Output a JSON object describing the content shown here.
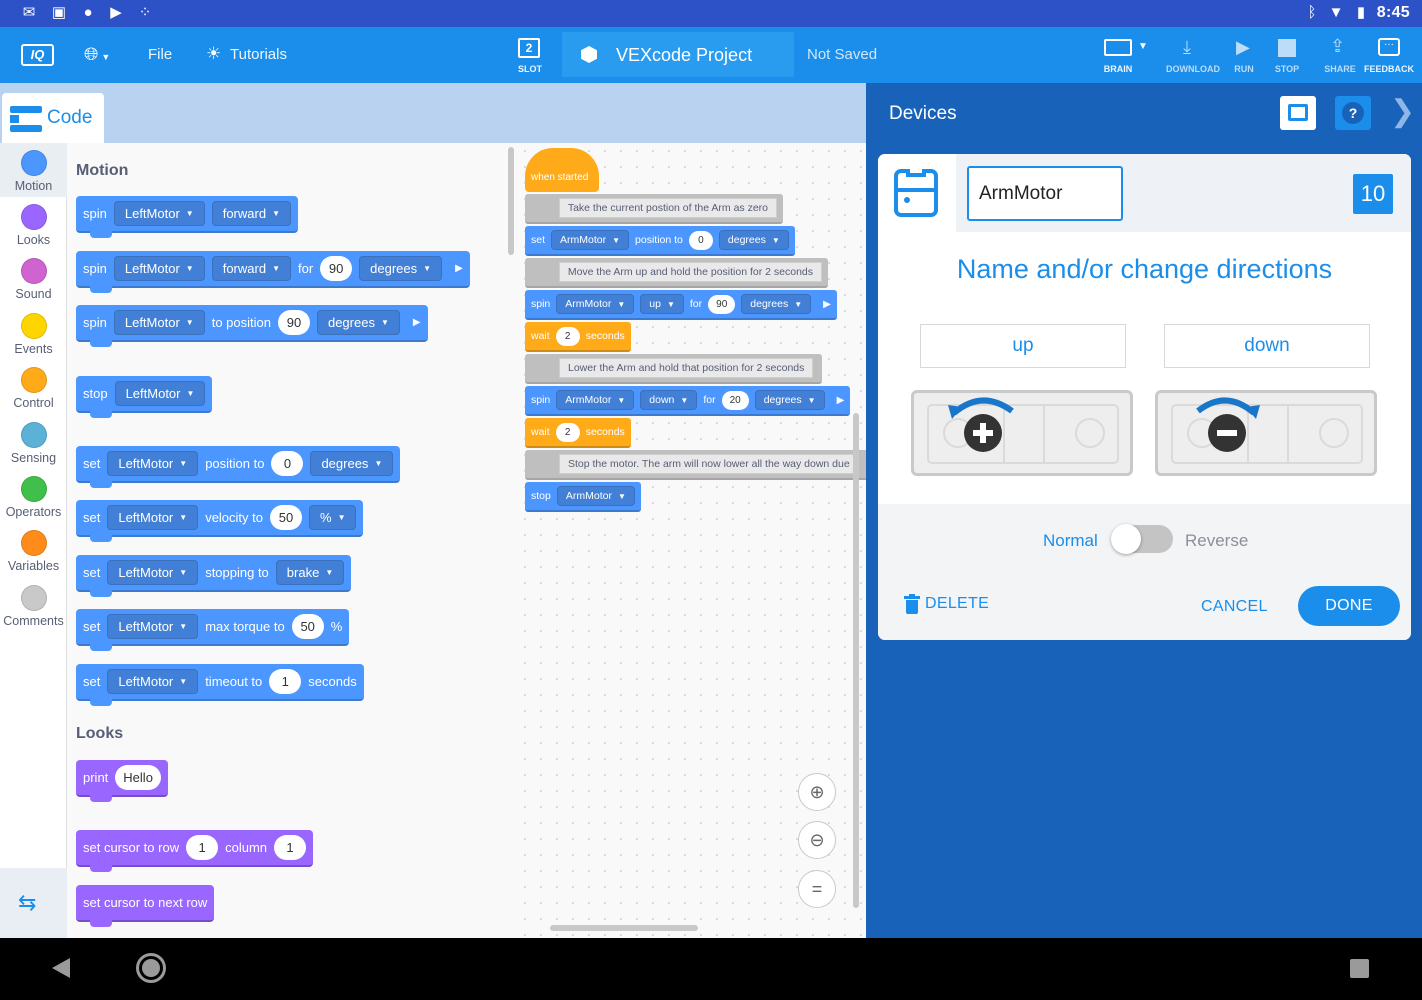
{
  "status_bar": {
    "time": "8:45"
  },
  "toolbar": {
    "file_label": "File",
    "tutorials_label": "Tutorials",
    "slot_number": "2",
    "slot_label": "SLOT",
    "project_name": "VEXcode Project",
    "save_status": "Not Saved",
    "brain_label": "BRAIN",
    "download_label": "DOWNLOAD",
    "run_label": "RUN",
    "stop_label": "STOP",
    "share_label": "SHARE",
    "feedback_label": "FEEDBACK"
  },
  "code_tab": {
    "label": "Code"
  },
  "categories": [
    {
      "label": "Motion",
      "color": "#4c97ff"
    },
    {
      "label": "Looks",
      "color": "#9966ff"
    },
    {
      "label": "Sound",
      "color": "#cf63cf"
    },
    {
      "label": "Events",
      "color": "#ffd500"
    },
    {
      "label": "Control",
      "color": "#ffab19"
    },
    {
      "label": "Sensing",
      "color": "#5cb1d6"
    },
    {
      "label": "Operators",
      "color": "#40bf4a"
    },
    {
      "label": "Variables",
      "color": "#ff8c1a"
    },
    {
      "label": "Comments",
      "color": "#c9c9c9"
    }
  ],
  "palette": {
    "motion_title": "Motion",
    "looks_title": "Looks",
    "blocks": {
      "b1": {
        "op": "spin",
        "motor": "LeftMotor",
        "dir": "forward"
      },
      "b2": {
        "op": "spin",
        "motor": "LeftMotor",
        "dir": "forward",
        "for": "for",
        "value": "90",
        "unit": "degrees"
      },
      "b3": {
        "op": "spin",
        "motor": "LeftMotor",
        "text": "to position",
        "value": "90",
        "unit": "degrees"
      },
      "b4": {
        "op": "stop",
        "motor": "LeftMotor"
      },
      "b5": {
        "op": "set",
        "motor": "LeftMotor",
        "text": "position to",
        "value": "0",
        "unit": "degrees"
      },
      "b6": {
        "op": "set",
        "motor": "LeftMotor",
        "text": "velocity to",
        "value": "50",
        "unit": "%"
      },
      "b7": {
        "op": "set",
        "motor": "LeftMotor",
        "text": "stopping to",
        "mode": "brake"
      },
      "b8": {
        "op": "set",
        "motor": "LeftMotor",
        "text": "max torque to",
        "value": "50",
        "unit": "%"
      },
      "b9": {
        "op": "set",
        "motor": "LeftMotor",
        "text": "timeout to",
        "value": "1",
        "unit": "seconds"
      },
      "l1": {
        "op": "print",
        "value": "Hello"
      },
      "l2": {
        "text": "set cursor to row",
        "row": "1",
        "col_text": "column",
        "col": "1"
      },
      "l3": {
        "text": "set cursor to next row"
      }
    }
  },
  "workspace": {
    "hat": "when started",
    "c1": "Take the current postion of the Arm as zero",
    "s1": {
      "op": "set",
      "motor": "ArmMotor",
      "text": "position to",
      "value": "0",
      "unit": "degrees"
    },
    "c2": "Move the Arm up and hold the position for 2 seconds",
    "s2": {
      "op": "spin",
      "motor": "ArmMotor",
      "dir": "up",
      "for": "for",
      "value": "90",
      "unit": "degrees"
    },
    "w1": {
      "op": "wait",
      "value": "2",
      "unit": "seconds"
    },
    "c3": "Lower the Arm and hold that position for 2 seconds",
    "s3": {
      "op": "spin",
      "motor": "ArmMotor",
      "dir": "down",
      "for": "for",
      "value": "20",
      "unit": "degrees"
    },
    "w2": {
      "op": "wait",
      "value": "2",
      "unit": "seconds"
    },
    "c4": "Stop the motor.  The arm will now lower all the way down due",
    "s4": {
      "op": "stop",
      "motor": "ArmMotor"
    },
    "zoom_reset": "="
  },
  "devices": {
    "title": "Devices",
    "help": "?",
    "device_name": "ArmMotor",
    "port": "10",
    "heading": "Name and/or change directions",
    "dir_plus": "up",
    "dir_minus": "down",
    "normal_label": "Normal",
    "reverse_label": "Reverse",
    "reversed": false,
    "delete_label": "DELETE",
    "cancel_label": "CANCEL",
    "done_label": "DONE"
  },
  "colors": {
    "accent": "#1a8eea",
    "panel": "#1862b9",
    "motion": "#4c97ff",
    "looks": "#9966ff",
    "control": "#ffab19"
  }
}
